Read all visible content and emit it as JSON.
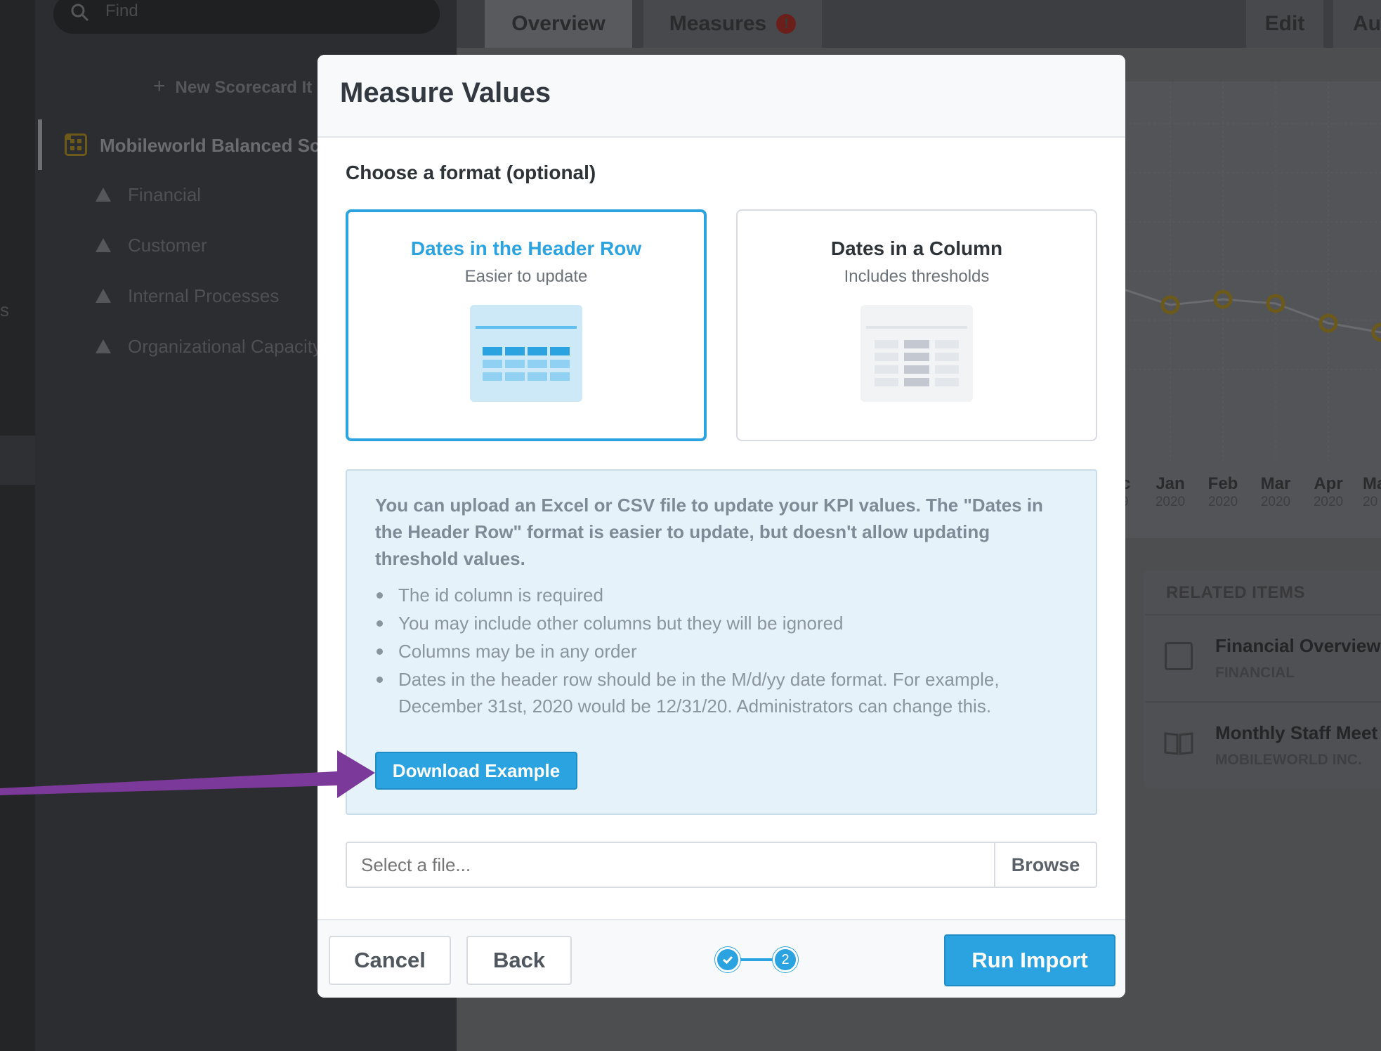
{
  "background": {
    "search_placeholder": "Find",
    "new_item_label": "New Scorecard It",
    "scorecard_label": "Mobileworld Balanced Sco",
    "tree_items": [
      "Financial",
      "Customer",
      "Internal Processes",
      "Organizational Capacity"
    ],
    "left_edge_char": "s",
    "tabs": {
      "overview": "Overview",
      "measures": "Measures",
      "measures_badge": "!",
      "edit": "Edit",
      "more": "Aug"
    },
    "chart_months": [
      {
        "month": "c",
        "year": "9"
      },
      {
        "month": "Jan",
        "year": "2020"
      },
      {
        "month": "Feb",
        "year": "2020"
      },
      {
        "month": "Mar",
        "year": "2020"
      },
      {
        "month": "Apr",
        "year": "2020"
      },
      {
        "month": "Ma",
        "year": "20"
      }
    ],
    "related": {
      "title": "RELATED ITEMS",
      "items": [
        {
          "name": "Financial Overview",
          "sub": "FINANCIAL"
        },
        {
          "name": "Monthly Staff Meet",
          "sub": "MOBILEWORLD INC."
        }
      ]
    }
  },
  "modal": {
    "title": "Measure Values",
    "section_label": "Choose a format (optional)",
    "formats": [
      {
        "title": "Dates in the Header Row",
        "subtitle": "Easier to update",
        "selected": true
      },
      {
        "title": "Dates in a Column",
        "subtitle": "Includes thresholds",
        "selected": false
      }
    ],
    "info": {
      "text": "You can upload an Excel or CSV file to update your KPI values. The \"Dates in the Header Row\" format is easier to update, but doesn't allow updating threshold values.",
      "bullets": [
        "The id column is required",
        "You may include other columns but they will be ignored",
        "Columns may be in any order",
        "Dates in the header row should be in the M/d/yy date format. For example, December 31st, 2020 would be 12/31/20. Administrators can change this."
      ],
      "download_label": "Download Example"
    },
    "file": {
      "placeholder": "Select a file...",
      "browse_label": "Browse"
    },
    "footer": {
      "cancel_label": "Cancel",
      "back_label": "Back",
      "step_current": "2",
      "run_label": "Run Import"
    }
  },
  "colors": {
    "accent": "#2ba3e0",
    "arrow": "#7b3a9a",
    "info_bg": "#e6f2fa",
    "chart_point": "#6b5a1a"
  },
  "icons": [
    "search-icon",
    "plus-icon",
    "scorecard-icon",
    "triangle-icon",
    "alert-icon",
    "dashboard-icon",
    "book-icon",
    "check-icon",
    "arrow-annotation"
  ]
}
